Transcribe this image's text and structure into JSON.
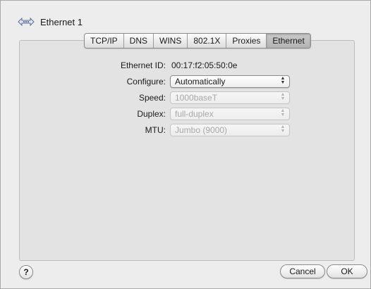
{
  "header": {
    "title": "Ethernet 1",
    "icon": "ethernet-icon"
  },
  "tabs": [
    {
      "label": "TCP/IP"
    },
    {
      "label": "DNS"
    },
    {
      "label": "WINS"
    },
    {
      "label": "802.1X"
    },
    {
      "label": "Proxies"
    },
    {
      "label": "Ethernet",
      "selected": true
    }
  ],
  "ethernet": {
    "id_label": "Ethernet ID:",
    "id_value": "00:17:f2:05:50:0e",
    "configure_label": "Configure:",
    "configure_value": "Automatically",
    "speed_label": "Speed:",
    "speed_value": "1000baseT",
    "duplex_label": "Duplex:",
    "duplex_value": "full-duplex",
    "mtu_label": "MTU:",
    "mtu_value": "Jumbo  (9000)"
  },
  "footer": {
    "help_label": "?",
    "cancel_label": "Cancel",
    "ok_label": "OK"
  }
}
